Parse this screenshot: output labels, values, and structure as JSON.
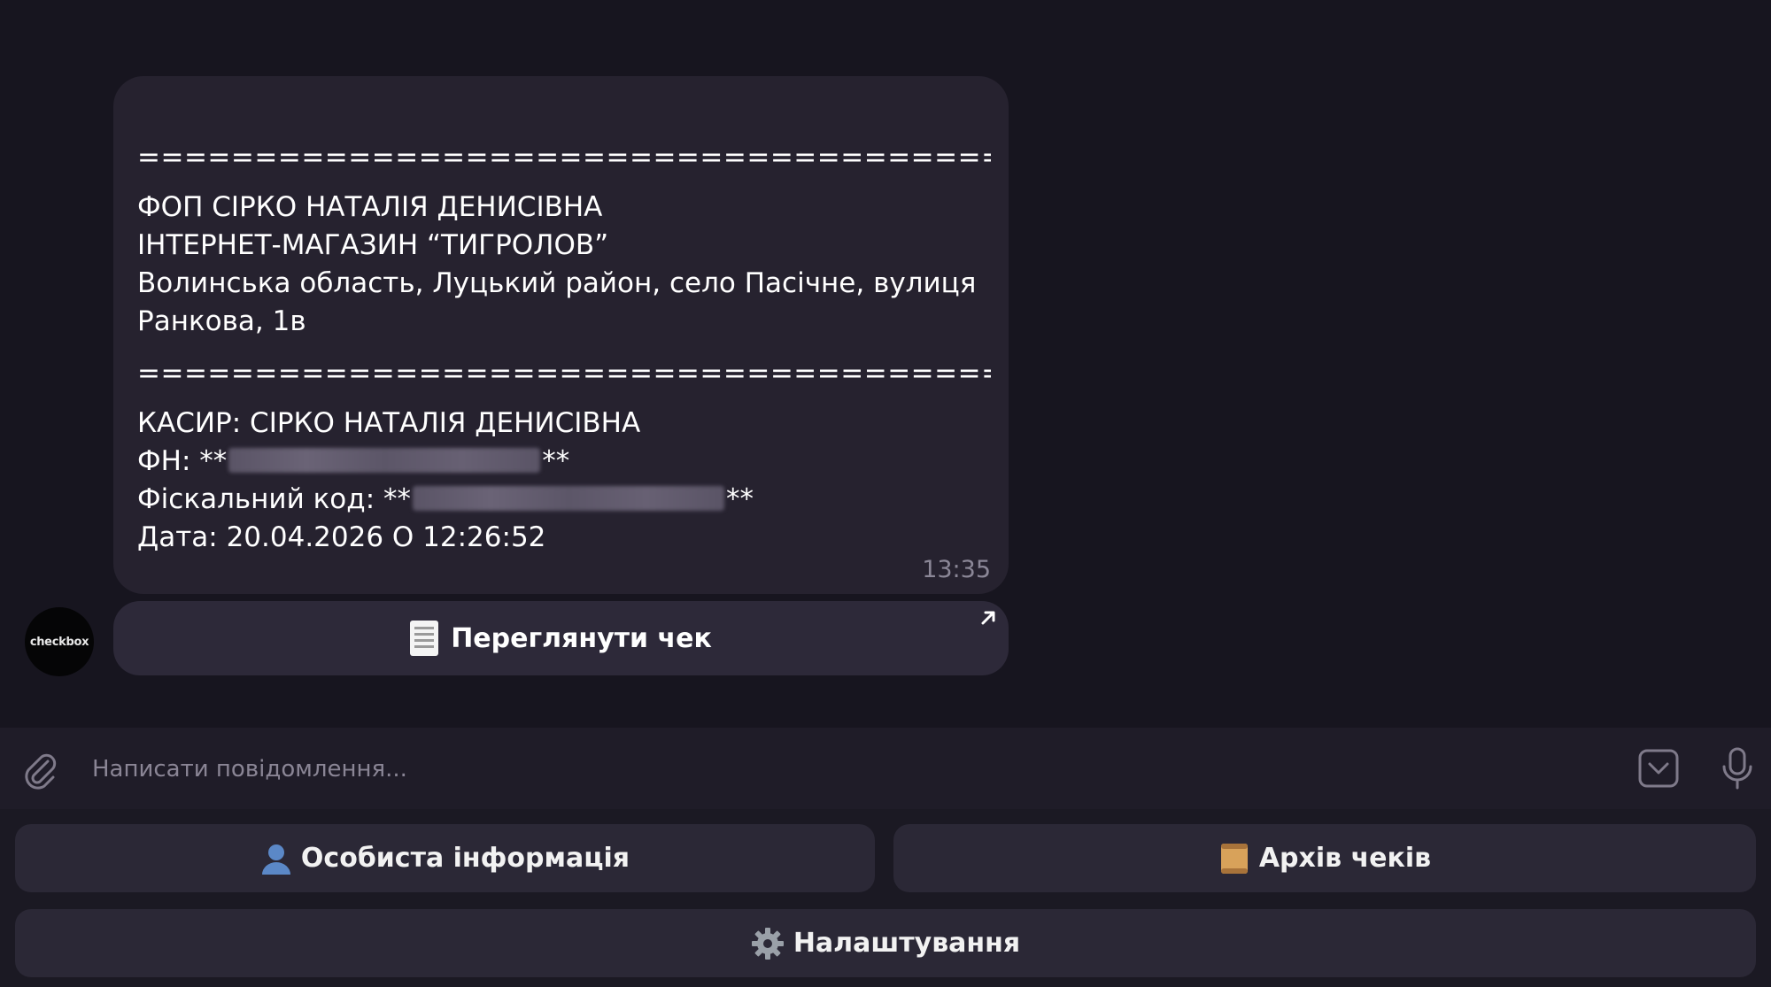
{
  "message": {
    "separator": "==================================================",
    "merchant_name": "ФОП СІРКО НАТАЛІЯ ДЕНИСІВНА",
    "store_name": "ІНТЕРНЕТ-МАГАЗИН “ТИГРОЛОВ”",
    "address_line1": "Волинська область, Луцький район, село Пасічне, вулиця",
    "address_line2": "Ранкова, 1в",
    "cashier": "КАСИР: СІРКО НАТАЛІЯ ДЕНИСІВНА",
    "fn_prefix": "ФН: **",
    "fn_suffix": "**",
    "fiscal_prefix": "Фіскальний код: **",
    "fiscal_suffix": "**",
    "date": "Дата: 20.04.2026 О 12:26:52",
    "time": "13:35"
  },
  "avatar": {
    "label": "checkbox"
  },
  "inline_button": {
    "label": "Переглянути чек",
    "icon": "receipt-icon"
  },
  "composer": {
    "placeholder": "Написати повідомлення..."
  },
  "keyboard": {
    "personal_info": "Особиста інформація",
    "receipt_archive": "Архів чеків",
    "settings": "Налаштування"
  },
  "colors": {
    "background": "#17151f",
    "bubble": "#26222f",
    "button": "#2b2836"
  }
}
